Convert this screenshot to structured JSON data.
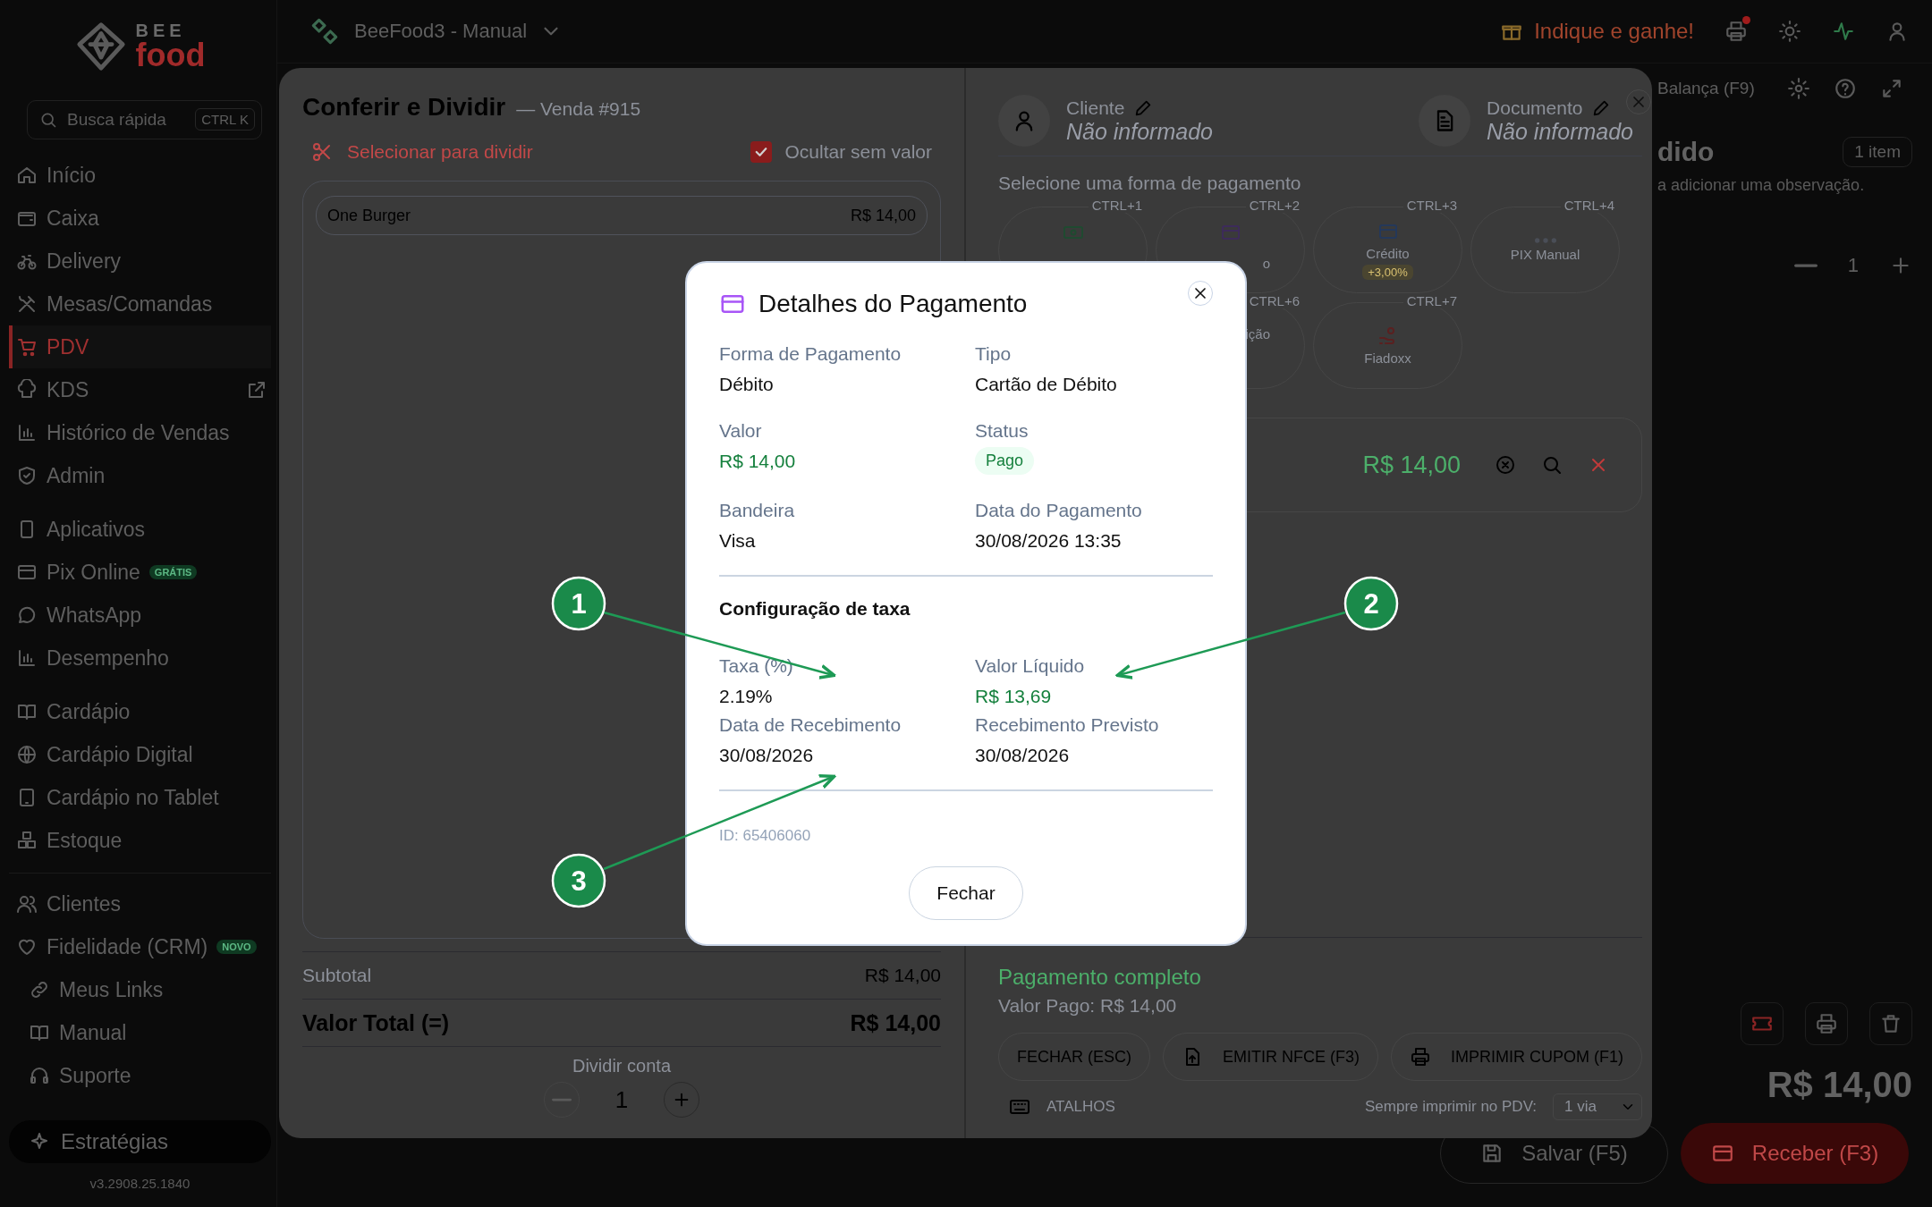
{
  "sidebar": {
    "logo_top": "BEE",
    "logo_bottom": "food",
    "search_placeholder": "Busca rápida",
    "search_shortcut": "CTRL K",
    "groups": [
      {
        "items": [
          {
            "label": "Início",
            "selected": false,
            "external": false
          },
          {
            "label": "Caixa",
            "selected": false,
            "external": false
          },
          {
            "label": "Delivery",
            "selected": false,
            "external": false
          },
          {
            "label": "Mesas/Comandas",
            "selected": false,
            "external": false
          },
          {
            "label": "PDV",
            "selected": true,
            "external": false
          },
          {
            "label": "KDS",
            "selected": false,
            "external": true
          },
          {
            "label": "Histórico de Vendas",
            "selected": false,
            "external": false
          },
          {
            "label": "Admin",
            "selected": false,
            "external": false
          }
        ]
      },
      {
        "items": [
          {
            "label": "Aplicativos",
            "selected": false,
            "external": false
          },
          {
            "label": "Pix Online",
            "selected": false,
            "external": false,
            "badge": "GRÁTIS"
          },
          {
            "label": "WhatsApp",
            "selected": false,
            "external": false
          },
          {
            "label": "Desempenho",
            "selected": false,
            "external": false
          }
        ]
      },
      {
        "items": [
          {
            "label": "Cardápio",
            "selected": false,
            "external": false
          },
          {
            "label": "Cardápio Digital",
            "selected": false,
            "external": false
          },
          {
            "label": "Cardápio no Tablet",
            "selected": false,
            "external": false
          },
          {
            "label": "Estoque",
            "selected": false,
            "external": false
          }
        ]
      },
      {
        "items": [
          {
            "label": "Clientes",
            "selected": false,
            "external": false
          },
          {
            "label": "Fidelidade (CRM)",
            "selected": false,
            "external": false,
            "badge": "NOVO"
          }
        ]
      },
      {
        "items": [
          {
            "label": "Meus Links",
            "selected": false,
            "external": false
          },
          {
            "label": "Manual",
            "selected": false,
            "external": false
          },
          {
            "label": "Suporte",
            "selected": false,
            "external": false
          }
        ]
      }
    ],
    "strategies": "Estratégias",
    "version": "v3.2908.25.1840"
  },
  "topbar": {
    "store": "BeeFood3 - Manual",
    "referral": "Indique e ganhe!",
    "printer_alert": true
  },
  "order_panel": {
    "toolbar_label": "Balança (F9)",
    "title": "dido",
    "count": "1 item",
    "hint": "a adicionar uma observação.",
    "qty": "1",
    "total": "R$ 14,00",
    "buttons": [
      {
        "label": "Salvar (F5)",
        "kind": "outline"
      },
      {
        "label": "Receber (F3)",
        "kind": "primary"
      }
    ]
  },
  "split": {
    "title": "Conferir e Dividir",
    "subtitle": "— Venda #915",
    "select_label": "Selecionar para dividir",
    "hide_empty": {
      "label": "Ocultar sem valor",
      "checked": true
    },
    "items": [
      {
        "name": "One Burger",
        "price": "R$ 14,00"
      }
    ],
    "subtotal_label": "Subtotal",
    "subtotal": "R$ 14,00",
    "total_label": "Valor Total (=)",
    "total": "R$ 14,00",
    "divide": {
      "label": "Dividir conta",
      "count": "1",
      "minus_disabled": true
    }
  },
  "payment": {
    "customer": {
      "label": "Cliente",
      "value": "Não informado"
    },
    "document": {
      "label": "Documento",
      "value": "Não informado"
    },
    "methods_label": "Selecione uma forma de pagamento",
    "methods": [
      {
        "shortcut": "CTRL+1",
        "kind": "covered"
      },
      {
        "shortcut": "CTRL+2",
        "kind": "covered",
        "label": "o"
      },
      {
        "shortcut": "CTRL+3",
        "kind": "card",
        "label": "Crédito",
        "fee": "+3,00%"
      },
      {
        "shortcut": "CTRL+4",
        "kind": "card",
        "label": "PIX Manual"
      },
      {
        "shortcut": "CTRL+6",
        "kind": "covered",
        "label": "ição"
      },
      {
        "shortcut": "CTRL+7",
        "kind": "card",
        "label": "Fiadoxx"
      }
    ],
    "entry_amount": "R$ 14,00",
    "status": "Pagamento completo",
    "paid": "Valor Pago: R$ 14,00",
    "actions": [
      "FECHAR (ESC)",
      "EMITIR NFCE (F3)",
      "IMPRIMIR CUPOM (F1)"
    ],
    "shortcuts_label": "ATALHOS",
    "print_label": "Sempre imprimir no PDV:",
    "print_value": "1 via"
  },
  "dialog": {
    "title": "Detalhes do Pagamento",
    "fields": [
      {
        "label": "Forma de Pagamento",
        "value": "Débito",
        "kind": "text"
      },
      {
        "label": "Tipo",
        "value": "Cartão de Débito",
        "kind": "text"
      },
      {
        "label": "Valor",
        "value": "R$ 14,00",
        "kind": "money"
      },
      {
        "label": "Status",
        "value": "Pago",
        "kind": "badge"
      },
      {
        "label": "Bandeira",
        "value": "Visa",
        "kind": "text"
      },
      {
        "label": "Data do Pagamento",
        "value": "30/08/2026 13:35",
        "kind": "text"
      }
    ],
    "fee_title": "Configuração de taxa",
    "fee_fields": [
      {
        "label": "Taxa (%)",
        "value": "2.19%",
        "kind": "text"
      },
      {
        "label": "Valor Líquido",
        "value": "R$ 13,69",
        "kind": "money"
      },
      {
        "label": "Data de Recebimento",
        "value": "30/08/2026",
        "kind": "text"
      },
      {
        "label": "Recebimento Previsto",
        "value": "30/08/2026",
        "kind": "text"
      }
    ],
    "id": "ID: 65406060",
    "close_button": "Fechar"
  },
  "callouts": [
    {
      "number": "1"
    },
    {
      "number": "2"
    },
    {
      "number": "3"
    }
  ]
}
